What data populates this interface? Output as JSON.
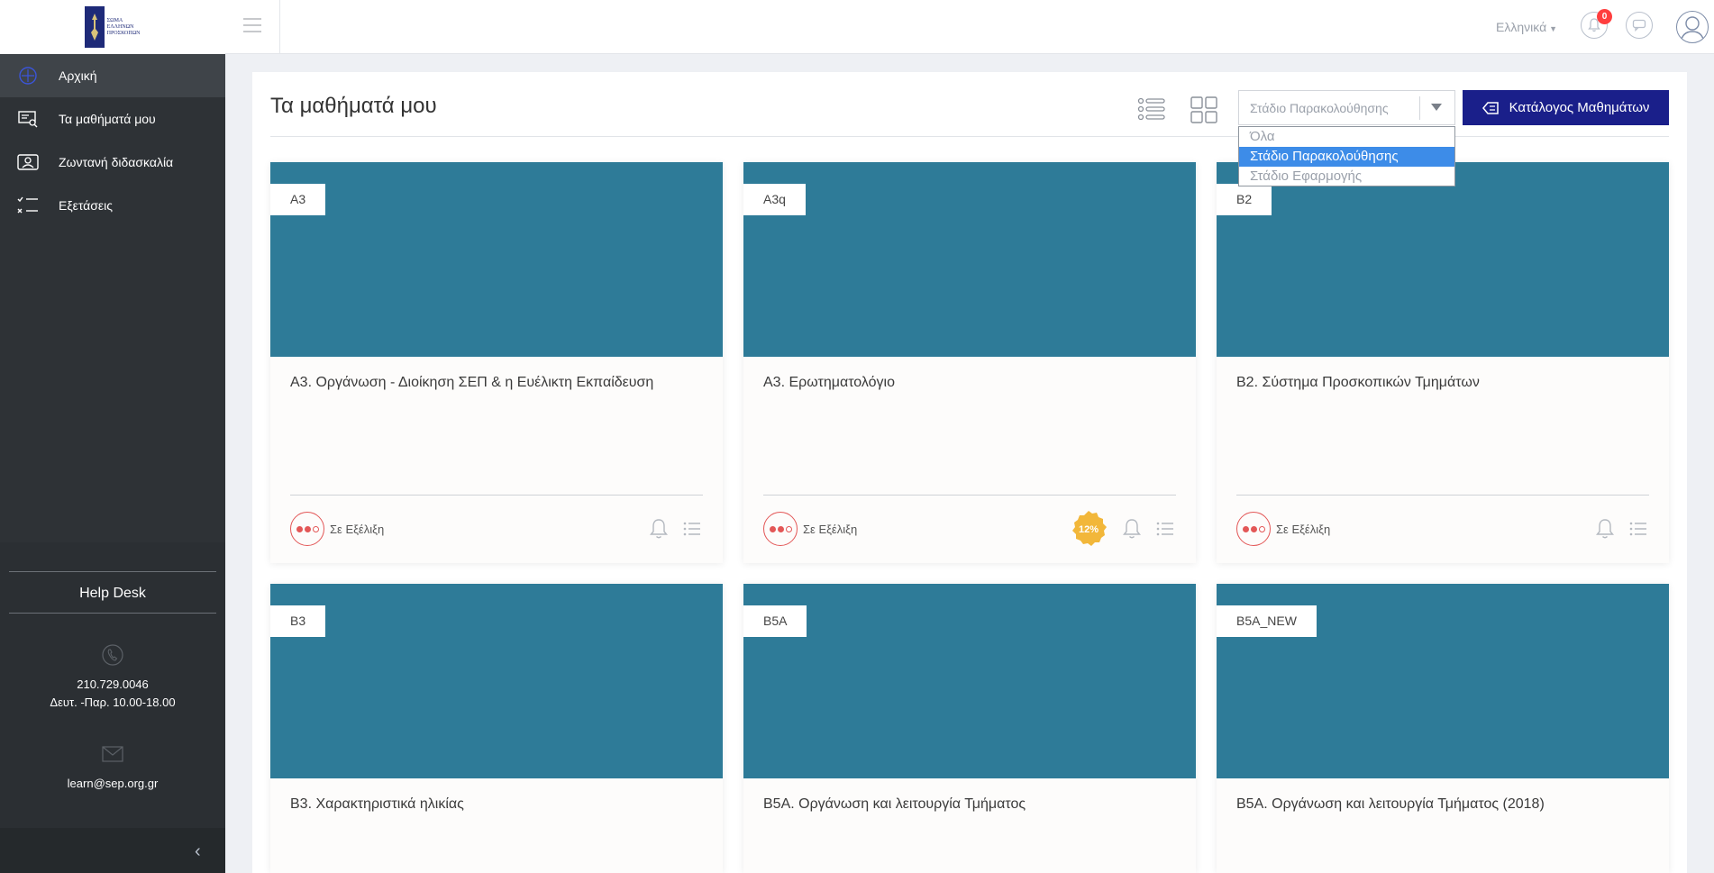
{
  "header": {
    "logo_text": "ΣΩΜΑ ΕΛΛΗΝΩΝ ΠΡΟΣΚΟΠΩΝ",
    "language": "Ελληνικά",
    "notification_count": "0"
  },
  "sidebar": {
    "items": [
      {
        "label": "Αρχική",
        "icon": "home-icon"
      },
      {
        "label": "Τα μαθήματά μου",
        "icon": "courses-icon"
      },
      {
        "label": "Ζωντανή διδασκαλία",
        "icon": "live-teaching-icon"
      },
      {
        "label": "Εξετάσεις",
        "icon": "exams-icon"
      }
    ],
    "help": {
      "title": "Help Desk",
      "phone": "210.729.0046",
      "hours": "Δευτ. -Παρ. 10.00-18.00",
      "email": "learn@sep.org.gr"
    }
  },
  "main": {
    "title": "Τα μαθήματά μου",
    "filter": {
      "selected": "Στάδιο Παρακολούθησης",
      "options": [
        "Όλα",
        "Στάδιο Παρακολούθησης",
        "Στάδιο Εφαρμογής"
      ]
    },
    "catalog_button": "Κατάλογος Μαθημάτων",
    "courses": [
      {
        "code": "Α3",
        "title": "Α3. Οργάνωση - Διοίκηση ΣΕΠ & η Ευέλικτη Εκπαίδευση",
        "status": "Σε Εξέλιξη",
        "progress": ""
      },
      {
        "code": "Α3q",
        "title": "Α3. Ερωτηματολόγιο",
        "status": "Σε Εξέλιξη",
        "progress": "12%"
      },
      {
        "code": "Β2",
        "title": "Β2. Σύστημα Προσκοπικών Τμημάτων",
        "status": "Σε Εξέλιξη",
        "progress": ""
      },
      {
        "code": "Β3",
        "title": "Β3. Χαρακτηριστικά ηλικίας",
        "status": "",
        "progress": ""
      },
      {
        "code": "Β5Α",
        "title": "Β5Α. Οργάνωση και λειτουργία Τμήματος",
        "status": "",
        "progress": ""
      },
      {
        "code": "Β5Α_NEW",
        "title": "Β5Α. Οργάνωση και λειτουργία Τμήματος (2018)",
        "status": "",
        "progress": ""
      }
    ]
  },
  "colors": {
    "sidebar_bg": "#2e3236",
    "card_thumb": "#2e7b98",
    "catalog_button": "#1a1f8a",
    "status_red": "#e35757",
    "progress_gold": "#f2b73a",
    "dropdown_selected": "#3d8ce8"
  }
}
